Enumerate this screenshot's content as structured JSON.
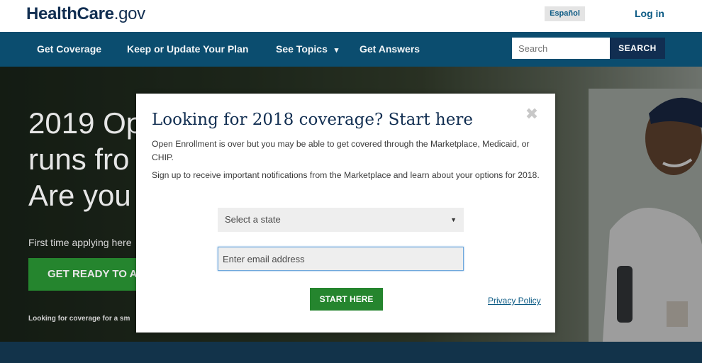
{
  "header": {
    "logo_bold": "HealthCare",
    "logo_light": ".gov",
    "language_label": "Español",
    "login_label": "Log in"
  },
  "nav": {
    "items": [
      {
        "label": "Get Coverage"
      },
      {
        "label": "Keep or Update Your Plan"
      },
      {
        "label": "See Topics"
      },
      {
        "label": "Get Answers"
      }
    ],
    "dropdown_caret": "▾",
    "search_placeholder": "Search",
    "search_button": "SEARCH"
  },
  "hero": {
    "title": "2019 Op\nruns fro\nAre you",
    "subtitle": "First time applying here",
    "button_label": "GET READY TO A",
    "small_text": "Looking for coverage for a sm"
  },
  "modal": {
    "title": "Looking for 2018 coverage? Start here",
    "close_glyph": "✖",
    "paragraph1": "Open Enrollment is over but you may be able to get covered through the Marketplace, Medicaid, or CHIP.",
    "paragraph2": "Sign up to receive important notifications from the Marketplace and learn about your options for 2018.",
    "state_select": {
      "selected": "Select a state",
      "caret": "▼"
    },
    "email_placeholder": "Enter email address",
    "start_button": "START HERE",
    "privacy_link": "Privacy Policy"
  },
  "colors": {
    "brand_navy": "#112e51",
    "nav_blue": "#0b4d6f",
    "cta_green": "#25852e",
    "link_blue": "#0b5a84"
  }
}
